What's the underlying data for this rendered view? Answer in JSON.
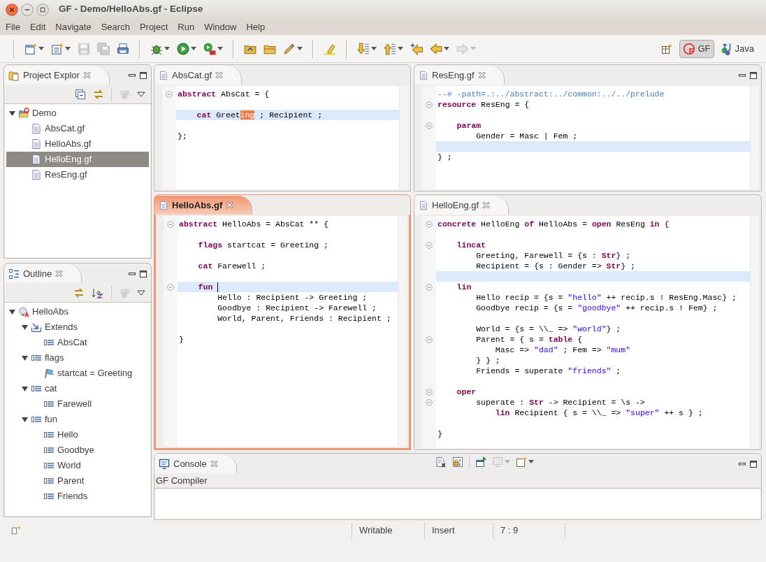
{
  "window": {
    "title": "GF - Demo/HelloAbs.gf - Eclipse"
  },
  "menu": [
    "File",
    "Edit",
    "Navigate",
    "Search",
    "Project",
    "Run",
    "Window",
    "Help"
  ],
  "toolbar": [
    {
      "kind": "separator"
    },
    {
      "kind": "new",
      "disabled": false,
      "menu": true
    },
    {
      "kind": "new-type",
      "disabled": false,
      "menu": true
    },
    {
      "kind": "save",
      "disabled": true,
      "menu": false
    },
    {
      "kind": "save-all",
      "disabled": true,
      "menu": false
    },
    {
      "kind": "print",
      "disabled": false,
      "menu": false
    },
    {
      "kind": "separator"
    },
    {
      "kind": "debug",
      "disabled": false,
      "menu": true
    },
    {
      "kind": "run",
      "disabled": false,
      "menu": true
    },
    {
      "kind": "external",
      "disabled": false,
      "menu": true
    },
    {
      "kind": "separator"
    },
    {
      "kind": "open-type",
      "disabled": false,
      "menu": false
    },
    {
      "kind": "open-task",
      "disabled": false,
      "menu": false
    },
    {
      "kind": "pen",
      "disabled": false,
      "menu": true
    },
    {
      "kind": "separator"
    },
    {
      "kind": "highlight",
      "disabled": false,
      "menu": false
    },
    {
      "kind": "separator"
    },
    {
      "kind": "next",
      "disabled": false,
      "menu": true
    },
    {
      "kind": "prev",
      "disabled": false,
      "menu": true
    },
    {
      "kind": "last-edit",
      "disabled": false,
      "menu": false
    },
    {
      "kind": "back",
      "disabled": false,
      "menu": true
    },
    {
      "kind": "forward",
      "disabled": true,
      "menu": true
    }
  ],
  "perspectives": [
    {
      "label": "GF",
      "kind": "gf",
      "selected": true
    },
    {
      "label": "Java",
      "kind": "java",
      "selected": false
    }
  ],
  "project_explorer": {
    "title": "Project Explor",
    "tree": [
      {
        "label": "Demo",
        "kind": "project",
        "expanded": true,
        "children": [
          {
            "label": "AbsCat.gf",
            "kind": "file",
            "selected": false
          },
          {
            "label": "HelloAbs.gf",
            "kind": "file",
            "selected": false
          },
          {
            "label": "HelloEng.gf",
            "kind": "file",
            "selected": true
          },
          {
            "label": "ResEng.gf",
            "kind": "file",
            "selected": false
          }
        ]
      }
    ]
  },
  "outline": {
    "title": "Outline",
    "tree": [
      {
        "label": "HelloAbs",
        "kind": "module",
        "expanded": true,
        "children": [
          {
            "label": "Extends",
            "kind": "extends",
            "expanded": true,
            "children": [
              {
                "label": "AbsCat",
                "kind": "item"
              }
            ]
          },
          {
            "label": "flags",
            "kind": "item",
            "expanded": true,
            "children": [
              {
                "label": "startcat = Greeting",
                "kind": "flag"
              }
            ]
          },
          {
            "label": "cat",
            "kind": "item",
            "expanded": true,
            "children": [
              {
                "label": "Farewell",
                "kind": "item"
              }
            ]
          },
          {
            "label": "fun",
            "kind": "item",
            "expanded": true,
            "children": [
              {
                "label": "Hello",
                "kind": "item"
              },
              {
                "label": "Goodbye",
                "kind": "item"
              },
              {
                "label": "World",
                "kind": "item"
              },
              {
                "label": "Parent",
                "kind": "item"
              },
              {
                "label": "Friends",
                "kind": "item"
              }
            ]
          }
        ]
      }
    ]
  },
  "editors": [
    {
      "tab": "AbsCat.gf",
      "active": false,
      "lines": [
        {
          "fold": true,
          "current": false,
          "tokens": [
            {
              "kind": "kw",
              "text": "abstract"
            },
            {
              "kind": "plain",
              "text": " AbsCat = {"
            }
          ]
        },
        {
          "fold": false,
          "current": false
        },
        {
          "fold": false,
          "current": true,
          "tokens": [
            {
              "kind": "kw",
              "text": "    cat"
            },
            {
              "kind": "plain",
              "text": " Greet"
            },
            {
              "kind": "mark",
              "text": "ing"
            },
            {
              "kind": "plain",
              "text": " ; Recipient ;"
            }
          ]
        },
        {
          "fold": false,
          "current": false
        },
        {
          "fold": false,
          "current": false,
          "tokens": [
            {
              "kind": "plain",
              "text": "};"
            }
          ]
        }
      ]
    },
    {
      "tab": "ResEng.gf",
      "active": false,
      "lines": [
        {
          "fold": false,
          "current": false,
          "tokens": [
            {
              "kind": "comment",
              "text": "--# -path=.:../abstract:../common:../../prelude"
            }
          ]
        },
        {
          "fold": true,
          "current": false,
          "tokens": [
            {
              "kind": "kw",
              "text": "resource"
            },
            {
              "kind": "plain",
              "text": " ResEng = {"
            }
          ]
        },
        {
          "fold": false,
          "current": false
        },
        {
          "fold": true,
          "current": false,
          "tokens": [
            {
              "kind": "kw",
              "text": "    param"
            }
          ]
        },
        {
          "fold": false,
          "current": false,
          "tokens": [
            {
              "kind": "plain",
              "text": "        Gender = Masc | Fem ;"
            }
          ]
        },
        {
          "fold": false,
          "current": true
        },
        {
          "fold": false,
          "current": false,
          "tokens": [
            {
              "kind": "plain",
              "text": "} ;"
            }
          ]
        }
      ]
    },
    {
      "tab": "HelloAbs.gf",
      "active": true,
      "lines": [
        {
          "fold": true,
          "current": false,
          "tokens": [
            {
              "kind": "kw",
              "text": "abstract"
            },
            {
              "kind": "plain",
              "text": " HelloAbs = AbsCat ** {"
            }
          ]
        },
        {
          "fold": false,
          "current": false
        },
        {
          "fold": false,
          "current": false,
          "tokens": [
            {
              "kind": "kw",
              "text": "    flags"
            },
            {
              "kind": "plain",
              "text": " startcat = Greeting ;"
            }
          ]
        },
        {
          "fold": false,
          "current": false
        },
        {
          "fold": false,
          "current": false,
          "tokens": [
            {
              "kind": "kw",
              "text": "    cat"
            },
            {
              "kind": "plain",
              "text": " Farewell ;"
            }
          ]
        },
        {
          "fold": false,
          "current": false
        },
        {
          "fold": true,
          "current": true,
          "caret": true,
          "tokens": [
            {
              "kind": "kw",
              "text": "    fun "
            }
          ]
        },
        {
          "fold": false,
          "current": false,
          "tokens": [
            {
              "kind": "plain",
              "text": "        Hello : Recipient -> Greeting ;"
            }
          ]
        },
        {
          "fold": false,
          "current": false,
          "tokens": [
            {
              "kind": "plain",
              "text": "        Goodbye : Recipient -> Farewell ;"
            }
          ]
        },
        {
          "fold": false,
          "current": false,
          "tokens": [
            {
              "kind": "plain",
              "text": "        World, Parent, Friends : Recipient ;"
            }
          ]
        },
        {
          "fold": false,
          "current": false
        },
        {
          "fold": false,
          "current": false,
          "tokens": [
            {
              "kind": "plain",
              "text": "}"
            }
          ]
        }
      ]
    },
    {
      "tab": "HelloEng.gf",
      "active": false,
      "lines": [
        {
          "fold": true,
          "current": false,
          "tokens": [
            {
              "kind": "kw",
              "text": "concrete"
            },
            {
              "kind": "plain",
              "text": " HelloEng "
            },
            {
              "kind": "kw",
              "text": "of"
            },
            {
              "kind": "plain",
              "text": " HelloAbs = "
            },
            {
              "kind": "kw",
              "text": "open"
            },
            {
              "kind": "plain",
              "text": " ResEng "
            },
            {
              "kind": "kw",
              "text": "in"
            },
            {
              "kind": "plain",
              "text": " {"
            }
          ]
        },
        {
          "fold": false,
          "current": false
        },
        {
          "fold": true,
          "current": false,
          "tokens": [
            {
              "kind": "kw",
              "text": "    lincat"
            }
          ]
        },
        {
          "fold": false,
          "current": false,
          "tokens": [
            {
              "kind": "plain",
              "text": "        Greeting, Farewell = {s : "
            },
            {
              "kind": "kw",
              "text": "Str"
            },
            {
              "kind": "plain",
              "text": "} ;"
            }
          ]
        },
        {
          "fold": false,
          "current": false,
          "tokens": [
            {
              "kind": "plain",
              "text": "        Recipient = {s : Gender => "
            },
            {
              "kind": "kw",
              "text": "Str"
            },
            {
              "kind": "plain",
              "text": "} ;"
            }
          ]
        },
        {
          "fold": false,
          "current": true
        },
        {
          "fold": true,
          "current": false,
          "tokens": [
            {
              "kind": "kw",
              "text": "    lin"
            }
          ]
        },
        {
          "fold": false,
          "current": false,
          "tokens": [
            {
              "kind": "plain",
              "text": "        Hello recip = {s = "
            },
            {
              "kind": "str",
              "text": "\"hello\""
            },
            {
              "kind": "plain",
              "text": " ++ recip.s ! ResEng.Masc} ;"
            }
          ]
        },
        {
          "fold": false,
          "current": false,
          "tokens": [
            {
              "kind": "plain",
              "text": "        Goodbye recip = {s = "
            },
            {
              "kind": "str",
              "text": "\"goodbye\""
            },
            {
              "kind": "plain",
              "text": " ++ recip.s ! Fem} ;"
            }
          ]
        },
        {
          "fold": false,
          "current": false
        },
        {
          "fold": false,
          "current": false,
          "tokens": [
            {
              "kind": "plain",
              "text": "        World = {s = \\\\_ => "
            },
            {
              "kind": "str",
              "text": "\"world\""
            },
            {
              "kind": "plain",
              "text": "} ;"
            }
          ]
        },
        {
          "fold": true,
          "current": false,
          "tokens": [
            {
              "kind": "plain",
              "text": "        Parent = { s = "
            },
            {
              "kind": "kw",
              "text": "table"
            },
            {
              "kind": "plain",
              "text": " {"
            }
          ]
        },
        {
          "fold": false,
          "current": false,
          "tokens": [
            {
              "kind": "plain",
              "text": "            Masc => "
            },
            {
              "kind": "str",
              "text": "\"dad\""
            },
            {
              "kind": "plain",
              "text": " ; Fem => "
            },
            {
              "kind": "str",
              "text": "\"mum\""
            }
          ]
        },
        {
          "fold": false,
          "current": false,
          "tokens": [
            {
              "kind": "plain",
              "text": "        } } ;"
            }
          ]
        },
        {
          "fold": false,
          "current": false,
          "tokens": [
            {
              "kind": "plain",
              "text": "        Friends = superate "
            },
            {
              "kind": "str",
              "text": "\"friends\""
            },
            {
              "kind": "plain",
              "text": " ;"
            }
          ]
        },
        {
          "fold": false,
          "current": false
        },
        {
          "fold": true,
          "current": false,
          "tokens": [
            {
              "kind": "kw",
              "text": "    oper"
            }
          ]
        },
        {
          "fold": true,
          "current": false,
          "tokens": [
            {
              "kind": "plain",
              "text": "        superate : "
            },
            {
              "kind": "kw",
              "text": "Str"
            },
            {
              "kind": "plain",
              "text": " -> Recipient = \\s ->"
            }
          ]
        },
        {
          "fold": false,
          "current": false,
          "tokens": [
            {
              "kind": "kw",
              "text": "            lin"
            },
            {
              "kind": "plain",
              "text": " Recipient { s = \\\\_ => "
            },
            {
              "kind": "str",
              "text": "\"super\""
            },
            {
              "kind": "plain",
              "text": " ++ s } ;"
            }
          ]
        },
        {
          "fold": false,
          "current": false
        },
        {
          "fold": false,
          "current": false,
          "tokens": [
            {
              "kind": "plain",
              "text": "}"
            }
          ]
        }
      ]
    }
  ],
  "console": {
    "title": "Console",
    "label": "GF Compiler"
  },
  "status_bar": [
    "Writable",
    "Insert",
    "7 : 9"
  ]
}
